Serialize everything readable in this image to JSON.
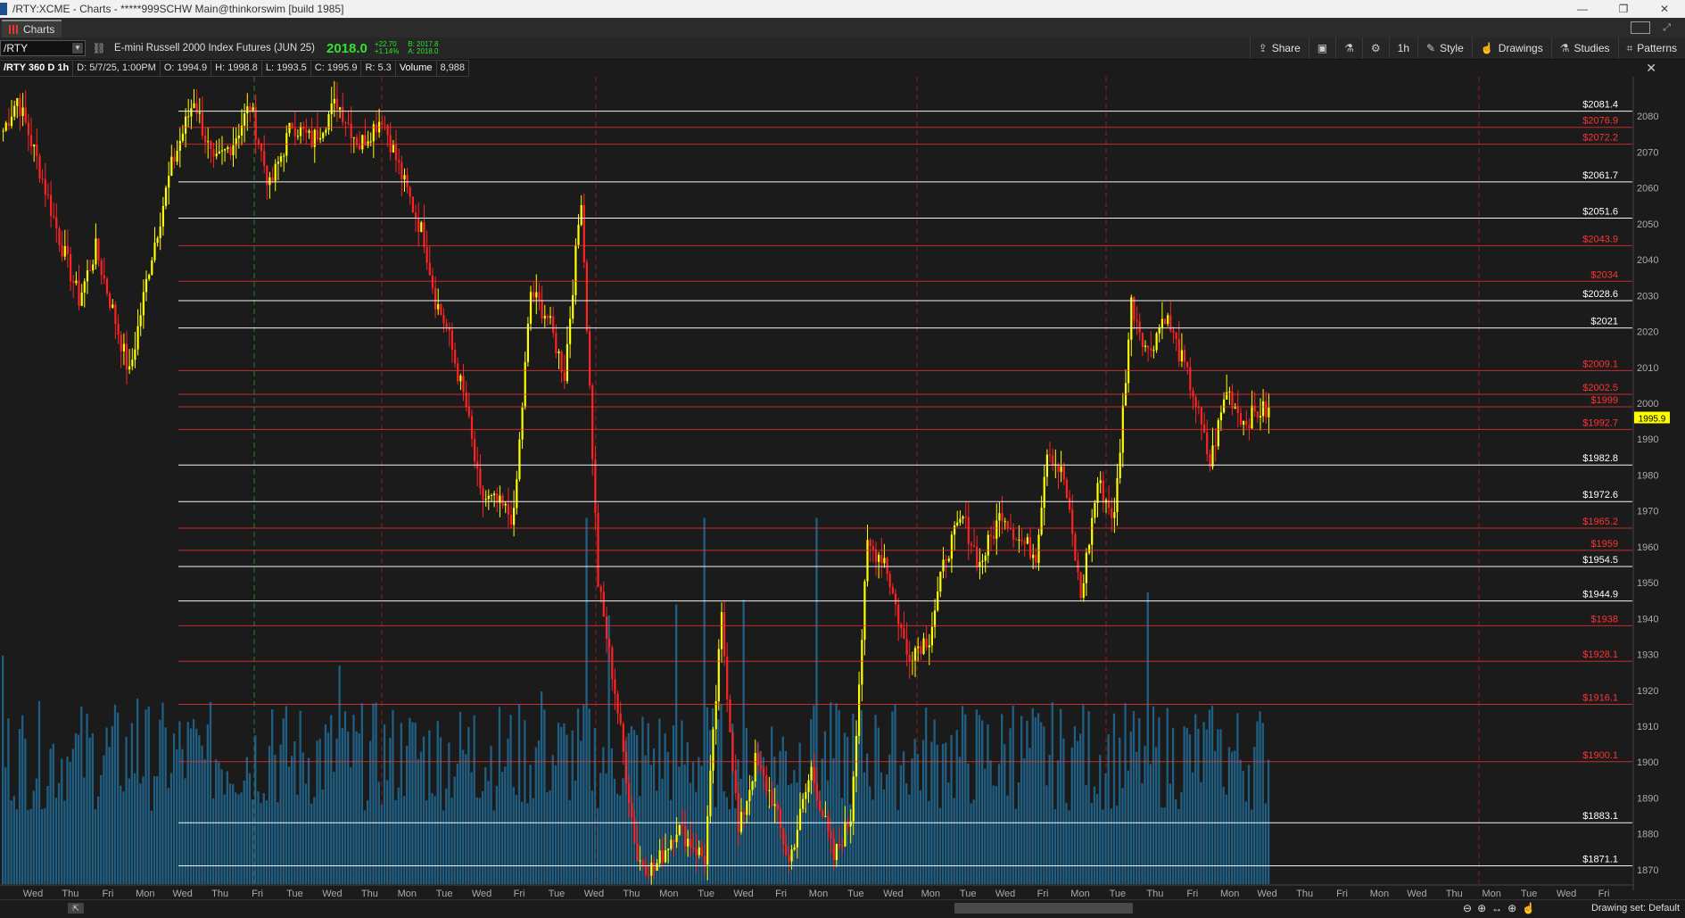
{
  "window": {
    "title": "/RTY:XCME - Charts - *****999SCHW Main@thinkorswim [build 1985]",
    "minimize": "—",
    "restore": "❐",
    "close": "✕"
  },
  "tab": {
    "label": "Charts"
  },
  "toolbar": {
    "symbol": "/RTY",
    "description": "E-mini Russell 2000 Index Futures (JUN 25)",
    "last": "2018.0",
    "change": "+22.70",
    "change_pct": "+1.14%",
    "bid": "B: 2017.8",
    "ask": "A: 2018.0",
    "share": "Share",
    "timeframe": "1h",
    "style": "Style",
    "drawings": "Drawings",
    "studies": "Studies",
    "patterns": "Patterns"
  },
  "infobar": {
    "chart_label": "/RTY 360 D 1h",
    "date": "D: 5/7/25, 1:00PM",
    "open": "O: 1994.9",
    "high": "H: 1998.8",
    "low": "L: 1993.5",
    "close": "C: 1995.9",
    "range": "R: 5.3",
    "volume_label": "Volume",
    "volume_value": "8,988"
  },
  "colors": {
    "up_candle": "#ffff00",
    "down_candle": "#ff2222",
    "volume_bar": "#1f5f84",
    "white_level": "#ffffff",
    "red_level": "#ff3333",
    "price_tag": "#ffff00"
  },
  "status": {
    "drawing_set": "Drawing set: Default"
  },
  "chart_data": {
    "type": "candlestick",
    "ylim": [
      1866,
      2091
    ],
    "yticks": [
      1870,
      1880,
      1890,
      1900,
      1910,
      1920,
      1930,
      1940,
      1950,
      1960,
      1970,
      1980,
      1990,
      2000,
      2010,
      2020,
      2030,
      2040,
      2050,
      2060,
      2070,
      2080
    ],
    "current_price": "1995.9",
    "xticks": [
      "Wed",
      "Thu",
      "Fri",
      "Mon",
      "Wed",
      "Thu",
      "Fri",
      "Tue",
      "Wed",
      "Thu",
      "Mon",
      "Tue",
      "Wed",
      "Fri",
      "Tue",
      "Wed",
      "Thu",
      "Mon",
      "Tue",
      "Wed",
      "Fri",
      "Mon",
      "Tue",
      "Wed",
      "Mon",
      "Tue",
      "Wed",
      "Fri",
      "Mon",
      "Tue",
      "Thu",
      "Fri",
      "Mon",
      "Wed",
      "Thu",
      "Fri",
      "Mon",
      "Wed",
      "Thu",
      "Mon",
      "Tue",
      "Wed",
      "Fri"
    ],
    "levels": [
      {
        "label": "$2081.4",
        "value": 2081.4,
        "color": "white"
      },
      {
        "label": "$2076.9",
        "value": 2076.9,
        "color": "red"
      },
      {
        "label": "$2072.2",
        "value": 2072.2,
        "color": "red"
      },
      {
        "label": "$2061.7",
        "value": 2061.7,
        "color": "white"
      },
      {
        "label": "$2051.6",
        "value": 2051.6,
        "color": "white"
      },
      {
        "label": "$2043.9",
        "value": 2043.9,
        "color": "red"
      },
      {
        "label": "$2034",
        "value": 2034,
        "color": "red"
      },
      {
        "label": "$2028.6",
        "value": 2028.6,
        "color": "white"
      },
      {
        "label": "$2021",
        "value": 2021,
        "color": "white"
      },
      {
        "label": "$2009.1",
        "value": 2009.1,
        "color": "red"
      },
      {
        "label": "$2002.5",
        "value": 2002.5,
        "color": "red"
      },
      {
        "label": "$1999",
        "value": 1999,
        "color": "red"
      },
      {
        "label": "$1992.7",
        "value": 1992.7,
        "color": "red"
      },
      {
        "label": "$1982.8",
        "value": 1982.8,
        "color": "white"
      },
      {
        "label": "$1972.6",
        "value": 1972.6,
        "color": "white"
      },
      {
        "label": "$1965.2",
        "value": 1965.2,
        "color": "red"
      },
      {
        "label": "$1959",
        "value": 1959,
        "color": "red"
      },
      {
        "label": "$1954.5",
        "value": 1954.5,
        "color": "white"
      },
      {
        "label": "$1944.9",
        "value": 1944.9,
        "color": "white"
      },
      {
        "label": "$1938",
        "value": 1938,
        "color": "red"
      },
      {
        "label": "$1928.1",
        "value": 1928.1,
        "color": "red"
      },
      {
        "label": "$1916.1",
        "value": 1916.1,
        "color": "red"
      },
      {
        "label": "$1900.1",
        "value": 1900.1,
        "color": "red"
      },
      {
        "label": "$1883.1",
        "value": 1883.1,
        "color": "white"
      },
      {
        "label": "$1871.1",
        "value": 1871.1,
        "color": "white"
      }
    ],
    "anchors": [
      [
        0,
        2076
      ],
      [
        5,
        2085
      ],
      [
        12,
        2068
      ],
      [
        20,
        2046
      ],
      [
        27,
        2029
      ],
      [
        33,
        2043
      ],
      [
        40,
        2023
      ],
      [
        45,
        2008
      ],
      [
        52,
        2038
      ],
      [
        60,
        2066
      ],
      [
        68,
        2085
      ],
      [
        75,
        2066
      ],
      [
        82,
        2073
      ],
      [
        88,
        2083
      ],
      [
        95,
        2060
      ],
      [
        103,
        2078
      ],
      [
        110,
        2073
      ],
      [
        119,
        2084
      ],
      [
        127,
        2072
      ],
      [
        135,
        2080
      ],
      [
        143,
        2061
      ],
      [
        150,
        2046
      ],
      [
        154,
        2029
      ],
      [
        158,
        2021
      ],
      [
        165,
        1999
      ],
      [
        170,
        1974
      ],
      [
        176,
        1972
      ],
      [
        182,
        1968
      ],
      [
        188,
        2031
      ],
      [
        194,
        2024
      ],
      [
        200,
        2008
      ],
      [
        206,
        2058
      ],
      [
        212,
        1950
      ],
      [
        218,
        1920
      ],
      [
        226,
        1873
      ],
      [
        232,
        1870
      ],
      [
        240,
        1882
      ],
      [
        250,
        1873
      ],
      [
        256,
        1940
      ],
      [
        262,
        1880
      ],
      [
        268,
        1900
      ],
      [
        274,
        1890
      ],
      [
        280,
        1872
      ],
      [
        288,
        1898
      ],
      [
        296,
        1873
      ],
      [
        302,
        1885
      ],
      [
        308,
        1960
      ],
      [
        314,
        1957
      ],
      [
        322,
        1930
      ],
      [
        330,
        1935
      ],
      [
        336,
        1958
      ],
      [
        342,
        1968
      ],
      [
        348,
        1955
      ],
      [
        356,
        1970
      ],
      [
        362,
        1962
      ],
      [
        368,
        1958
      ],
      [
        372,
        1988
      ],
      [
        378,
        1979
      ],
      [
        384,
        1946
      ],
      [
        390,
        1978
      ],
      [
        396,
        1968
      ],
      [
        402,
        2028
      ],
      [
        408,
        2014
      ],
      [
        414,
        2025
      ],
      [
        420,
        2012
      ],
      [
        424,
        2003
      ],
      [
        430,
        1983
      ],
      [
        436,
        2004
      ],
      [
        442,
        1995
      ],
      [
        448,
        1998
      ]
    ],
    "volume_ylim": [
      0,
      38000
    ]
  }
}
